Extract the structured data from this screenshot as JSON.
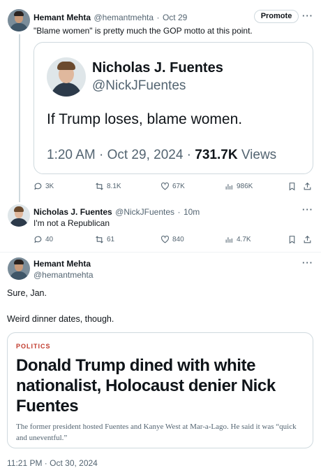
{
  "post1": {
    "name": "Hemant Mehta",
    "handle": "@hemantmehta",
    "date": "Oct 29",
    "promote_label": "Promote",
    "more_label": "···",
    "text": "\"Blame women\" is pretty much the GOP motto at this point.",
    "quote": {
      "name": "Nicholas J. Fuentes",
      "handle": "@NickJFuentes",
      "text": "If Trump loses, blame women.",
      "time_prefix": "1:20 AM · Oct 29, 2024 · ",
      "views_count": "731.7K",
      "views_label": " Views"
    },
    "stats": {
      "replies": "3K",
      "reposts": "8.1K",
      "likes": "67K",
      "views": "986K"
    }
  },
  "post2": {
    "name": "Nicholas J. Fuentes",
    "handle": "@NickJFuentes",
    "age": "10m",
    "more_label": "···",
    "text": "I'm not a Republican",
    "stats": {
      "replies": "40",
      "reposts": "61",
      "likes": "840",
      "views": "4.7K"
    }
  },
  "post3": {
    "name": "Hemant Mehta",
    "handle": "@hemantmehta",
    "more_label": "···",
    "line1": "Sure, Jan.",
    "line2": "Weird dinner dates, though.",
    "article": {
      "category": "POLITICS",
      "headline": "Donald Trump dined with white nationalist, Holocaust denier Nick Fuentes",
      "description": "The former president hosted Fuentes and Kanye West at Mar-a-Lago. He said it was “quick and uneventful.”"
    },
    "timestamp": "11:21 PM · Oct 30, 2024"
  },
  "icons": [
    "reply-icon",
    "repost-icon",
    "like-icon",
    "views-icon",
    "bookmark-icon",
    "share-icon",
    "more-icon"
  ],
  "colors": {
    "text": "#0f1419",
    "muted": "#536471",
    "border": "#cfd9de",
    "category": "#c0392b"
  }
}
